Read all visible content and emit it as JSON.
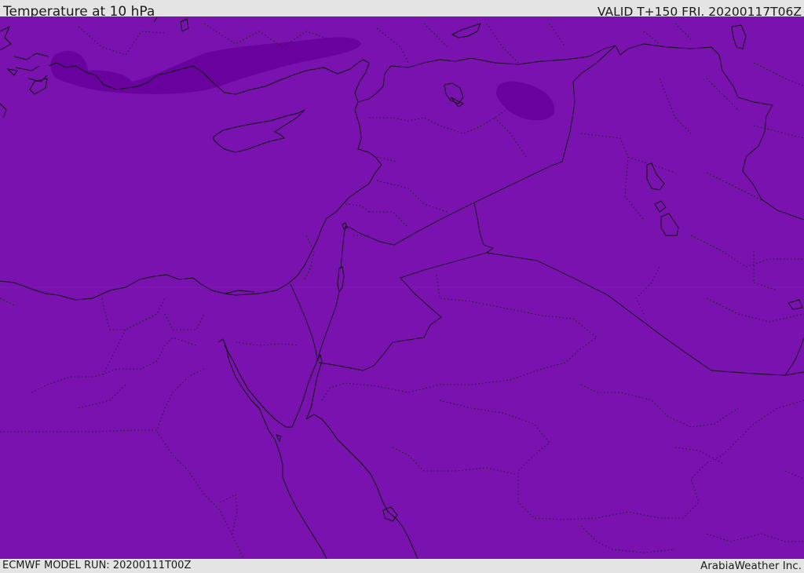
{
  "header": {
    "title": "Temperature at 10 hPa",
    "valid_time": "VALID T+150 FRI. 20200117T06Z"
  },
  "footer": {
    "model_run": "ECMWF MODEL RUN: 20200111T00Z",
    "credit": "ArabiaWeather Inc."
  },
  "map": {
    "fill_color": "#7a12b0",
    "cold_patch_color": "#6a02a0",
    "coastline_color": "#111111"
  }
}
